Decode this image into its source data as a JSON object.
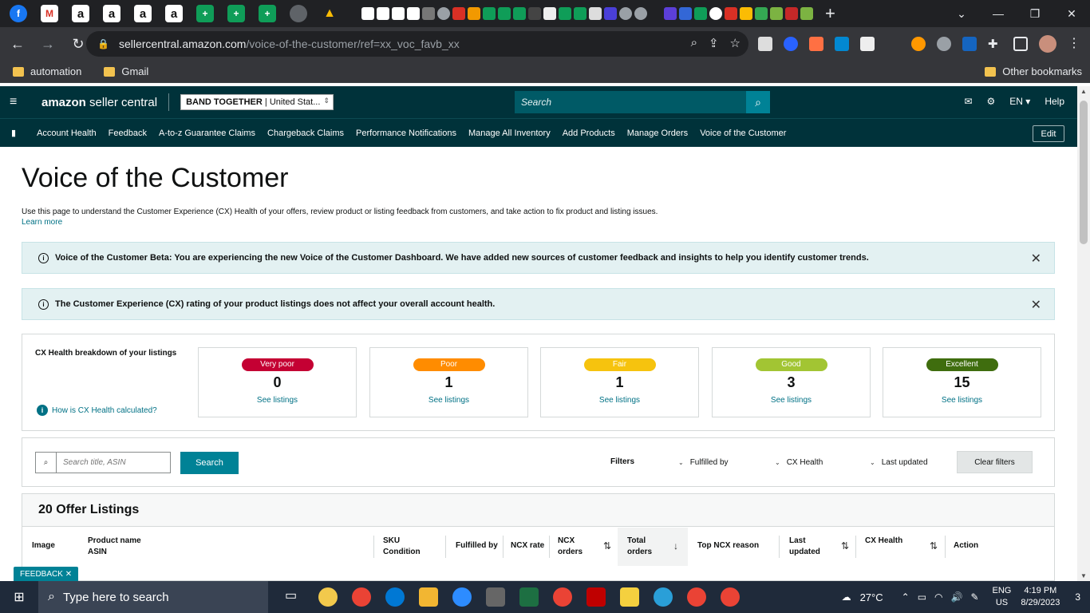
{
  "browser": {
    "url_host": "sellercentral.amazon.com",
    "url_path": "/voice-of-the-customer/ref=xx_voc_favb_xx",
    "bookmarks": [
      "automation",
      "Gmail"
    ],
    "other_bookmarks": "Other bookmarks"
  },
  "header": {
    "logo_text": "amazon",
    "logo_suffix": "seller central",
    "store_name": "BAND TOGETHER",
    "store_region": "United Stat...",
    "search_placeholder": "Search",
    "language": "EN",
    "help": "Help"
  },
  "nav": {
    "items": [
      "Account Health",
      "Feedback",
      "A-to-z Guarantee Claims",
      "Chargeback Claims",
      "Performance Notifications",
      "Manage All Inventory",
      "Add Products",
      "Manage Orders",
      "Voice of the Customer"
    ],
    "edit": "Edit"
  },
  "page": {
    "title": "Voice of the Customer",
    "description": "Use this page to understand the Customer Experience (CX) Health of your offers, review product or listing feedback from customers, and take action to fix product and listing issues.",
    "learn_more": "Learn more"
  },
  "banners": [
    {
      "text": "Voice of the Customer Beta: You are experiencing the new Voice of the Customer Dashboard. We have added new sources of customer feedback and insights to help you identify customer trends."
    },
    {
      "text": "The Customer Experience (CX) rating of your product listings does not affect your overall account health."
    }
  ],
  "cx_health": {
    "title": "CX Health breakdown of your listings",
    "how_link": "How is CX Health calculated?",
    "cards": [
      {
        "label": "Very poor",
        "count": "0",
        "link": "See listings",
        "color": "#c40033"
      },
      {
        "label": "Poor",
        "count": "1",
        "link": "See listings",
        "color": "#ff8c00"
      },
      {
        "label": "Fair",
        "count": "1",
        "link": "See listings",
        "color": "#f6c30e"
      },
      {
        "label": "Good",
        "count": "3",
        "link": "See listings",
        "color": "#a2c533"
      },
      {
        "label": "Excellent",
        "count": "15",
        "link": "See listings",
        "color": "#3f6d0e"
      }
    ]
  },
  "filters": {
    "search_placeholder": "Search title, ASIN",
    "search_button": "Search",
    "label": "Filters",
    "fulfilled_by": "Fulfilled by",
    "cx_health": "CX Health",
    "last_updated": "Last updated",
    "clear": "Clear filters"
  },
  "listings": {
    "title": "20 Offer Listings",
    "columns": {
      "image": "Image",
      "product_name": "Product name",
      "asin": "ASIN",
      "sku": "SKU",
      "condition": "Condition",
      "fulfilled_by": "Fulfilled by",
      "ncx_rate": "NCX rate",
      "ncx": "NCX",
      "orders": "orders",
      "total": "Total",
      "total_orders": "orders",
      "top_ncx": "Top NCX reason",
      "last": "Last",
      "updated": "updated",
      "cx_health": "CX Health",
      "action": "Action"
    }
  },
  "feedback_tab": "FEEDBACK",
  "taskbar": {
    "search_placeholder": "Type here to search",
    "temperature": "27°C",
    "lang1": "ENG",
    "lang2": "US",
    "time": "4:19 PM",
    "date": "8/29/2023",
    "notifications": "3"
  }
}
